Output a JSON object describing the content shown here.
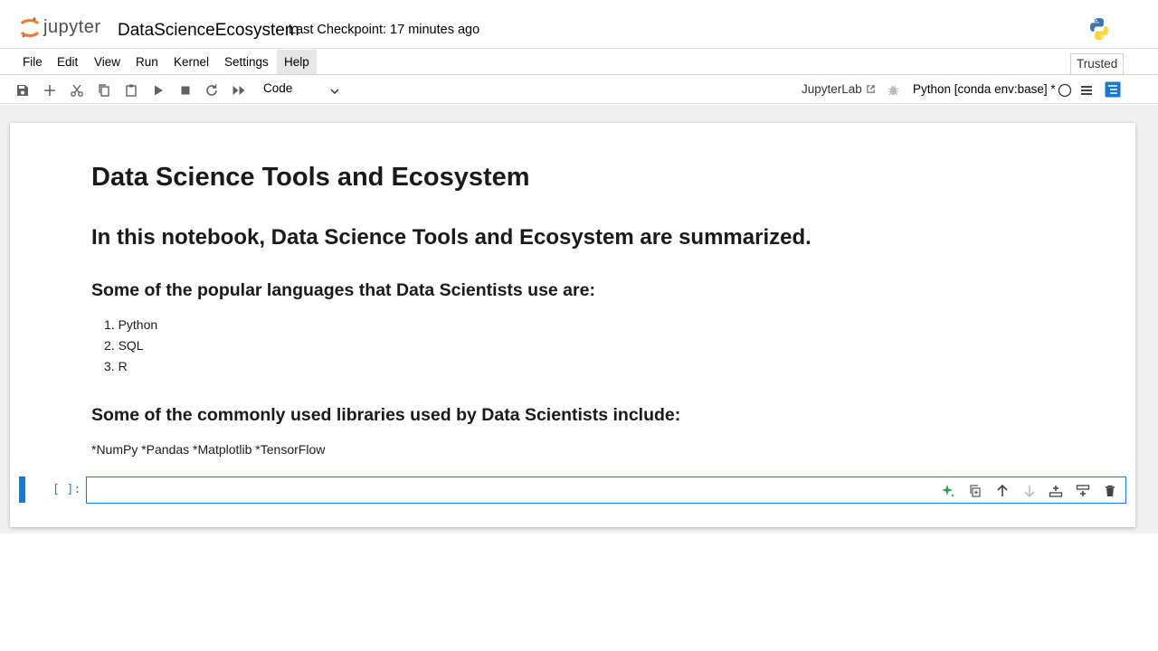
{
  "header": {
    "logo_text": "jupyter",
    "notebook_title": "DataScienceEcosystem",
    "checkpoint": "Last Checkpoint: 17 minutes ago"
  },
  "menu": [
    "File",
    "Edit",
    "View",
    "Run",
    "Kernel",
    "Settings",
    "Help"
  ],
  "trusted": "Trusted",
  "toolbar": {
    "cell_type": "Code",
    "jupyterlab_link": "JupyterLab",
    "kernel": "Python [conda env:base] *",
    "icons": [
      "save-icon",
      "add-cell-icon",
      "cut-icon",
      "copy-icon",
      "paste-icon",
      "run-icon",
      "stop-icon",
      "restart-icon",
      "run-all-icon"
    ]
  },
  "notebook": {
    "h1": "Data Science Tools and Ecosystem",
    "h2": "In this notebook, Data Science Tools and Ecosystem are summarized.",
    "languages_heading": "Some of the popular languages that Data Scientists use are:",
    "languages": [
      "1. Python",
      "2. SQL",
      "3. R"
    ],
    "libraries_heading": "Some of the commonly used libraries used by Data Scientists include:",
    "libraries_text": "*NumPy *Pandas *Matplotlib *TensorFlow",
    "prompt": "[ ]:"
  },
  "colors": {
    "accent": "#1976d2",
    "prompt": "#307fc1",
    "ai_icon": "#2e9e4f"
  }
}
